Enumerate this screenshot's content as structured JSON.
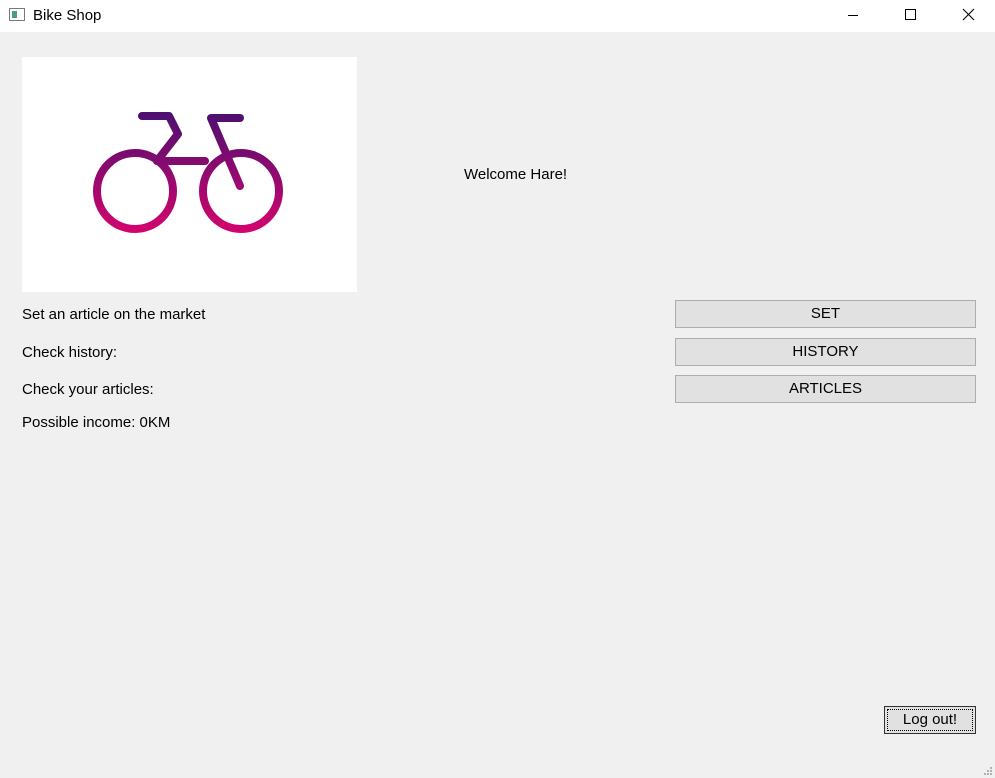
{
  "window": {
    "title": "Bike Shop"
  },
  "logo": {
    "icon": "bicycle-icon",
    "colors": [
      "#4b1070",
      "#d4046e"
    ]
  },
  "welcome": "Welcome Hare!",
  "actions": {
    "set": {
      "label": "Set an article on the market",
      "button": "SET"
    },
    "history": {
      "label": "Check history:",
      "button": "HISTORY"
    },
    "articles": {
      "label": "Check your articles:",
      "button": "ARTICLES"
    }
  },
  "income": "Possible income: 0KM",
  "logout": "Log out!"
}
